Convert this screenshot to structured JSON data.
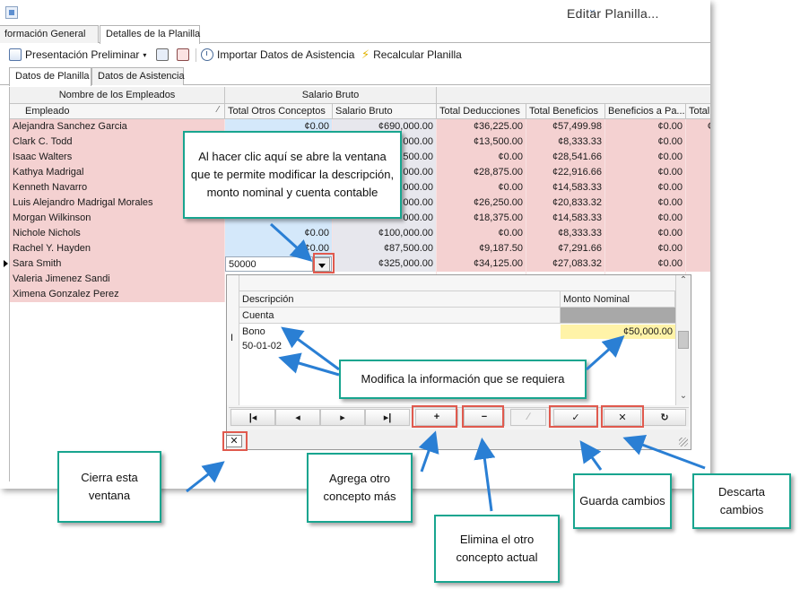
{
  "window": {
    "title": "Editar Planilla..."
  },
  "tabs_main": [
    {
      "label": "formación General",
      "active": false
    },
    {
      "label": "Detalles de la Planilla",
      "active": true
    }
  ],
  "toolbar": {
    "preview_label": "Presentación Preliminar",
    "import_label": "Importar Datos de Asistencia",
    "recalc_label": "Recalcular Planilla"
  },
  "tabs_sub": [
    {
      "label": "Datos de Planilla",
      "active": true
    },
    {
      "label": "Datos de Asistencia",
      "active": false
    }
  ],
  "grid": {
    "bands": {
      "employees": "Nombre de los Empleados",
      "salary": "Salario Bruto"
    },
    "columns": [
      "Empleado",
      "Total Otros Conceptos",
      "Salario Bruto",
      "Total Deducciones",
      "Total Beneficios",
      "Beneficios a Pa...",
      "Total"
    ],
    "rows": [
      {
        "name": "Alejandra Sanchez Garcia",
        "otros": "¢0.00",
        "bruto": "¢690,000.00",
        "deducciones": "¢36,225.00",
        "beneficios": "¢57,499.98",
        "beneficios_pa": "¢0.00",
        "total": "¢0"
      },
      {
        "name": "Clark C. Todd",
        "otros": "",
        "bruto": "000.00",
        "deducciones": "¢13,500.00",
        "beneficios": "¢8,333.33",
        "beneficios_pa": "¢0.00",
        "total": ""
      },
      {
        "name": "Isaac Walters",
        "otros": "",
        "bruto": "500.00",
        "deducciones": "¢0.00",
        "beneficios": "¢28,541.66",
        "beneficios_pa": "¢0.00",
        "total": ""
      },
      {
        "name": "Kathya Madrigal",
        "otros": "",
        "bruto": "000.00",
        "deducciones": "¢28,875.00",
        "beneficios": "¢22,916.66",
        "beneficios_pa": "¢0.00",
        "total": ""
      },
      {
        "name": "Kenneth Navarro",
        "otros": "",
        "bruto": "000.00",
        "deducciones": "¢0.00",
        "beneficios": "¢14,583.33",
        "beneficios_pa": "¢0.00",
        "total": ""
      },
      {
        "name": "Luis Alejandro Madrigal Morales",
        "otros": "",
        "bruto": "000.00",
        "deducciones": "¢26,250.00",
        "beneficios": "¢20,833.32",
        "beneficios_pa": "¢0.00",
        "total": ""
      },
      {
        "name": "Morgan Wilkinson",
        "otros": "",
        "bruto": "000.00",
        "deducciones": "¢18,375.00",
        "beneficios": "¢14,583.33",
        "beneficios_pa": "¢0.00",
        "total": ""
      },
      {
        "name": "Nichole Nichols",
        "otros": "¢0.00",
        "bruto": "¢100,000.00",
        "deducciones": "¢0.00",
        "beneficios": "¢8,333.33",
        "beneficios_pa": "¢0.00",
        "total": ""
      },
      {
        "name": "Rachel Y. Hayden",
        "otros": "¢0.00",
        "bruto": "¢87,500.00",
        "deducciones": "¢9,187.50",
        "beneficios": "¢7,291.66",
        "beneficios_pa": "¢0.00",
        "total": ""
      },
      {
        "name": "Sara Smith",
        "otros": "50000",
        "bruto": "¢325,000.00",
        "deducciones": "¢34,125.00",
        "beneficios": "¢27,083.32",
        "beneficios_pa": "¢0.00",
        "total": "",
        "current": true
      },
      {
        "name": "Valeria Jimenez Sandi",
        "otros": "",
        "bruto": "",
        "deducciones": "",
        "beneficios": "",
        "beneficios_pa": "",
        "total": ""
      },
      {
        "name": "Ximena Gonzalez Perez",
        "otros": "",
        "bruto": "",
        "deducciones": "",
        "beneficios": "",
        "beneficios_pa": "",
        "total": ""
      }
    ]
  },
  "popup": {
    "col_description": "Descripción",
    "col_amount": "Monto Nominal",
    "sub_account": "Cuenta",
    "value_description": "Bono",
    "value_account": "50-01-02",
    "value_amount": "¢50,000.00",
    "nav": [
      "|◂",
      "◂",
      "▸",
      "▸|",
      "+",
      "−",
      "∕",
      "✓",
      "✕",
      "↻"
    ],
    "close_label": "✕"
  },
  "callouts": {
    "dropdown": "Al hacer clic aquí se abre la ventana que te permite modificar la descripción, monto nominal y cuenta contable",
    "modify": "Modifica la información que se requiera",
    "close": "Cierra esta ventana",
    "add": "Agrega otro concepto más",
    "delete": "Elimina el otro concepto actual",
    "save": "Guarda cambios",
    "discard": "Descarta cambios"
  },
  "colors": {
    "callout_border": "#18a58f",
    "highlight": "#e05a4e",
    "arrow": "#2a7fd4",
    "row_pink": "#f4d1d1",
    "cell_blue": "#d4e8fa"
  }
}
